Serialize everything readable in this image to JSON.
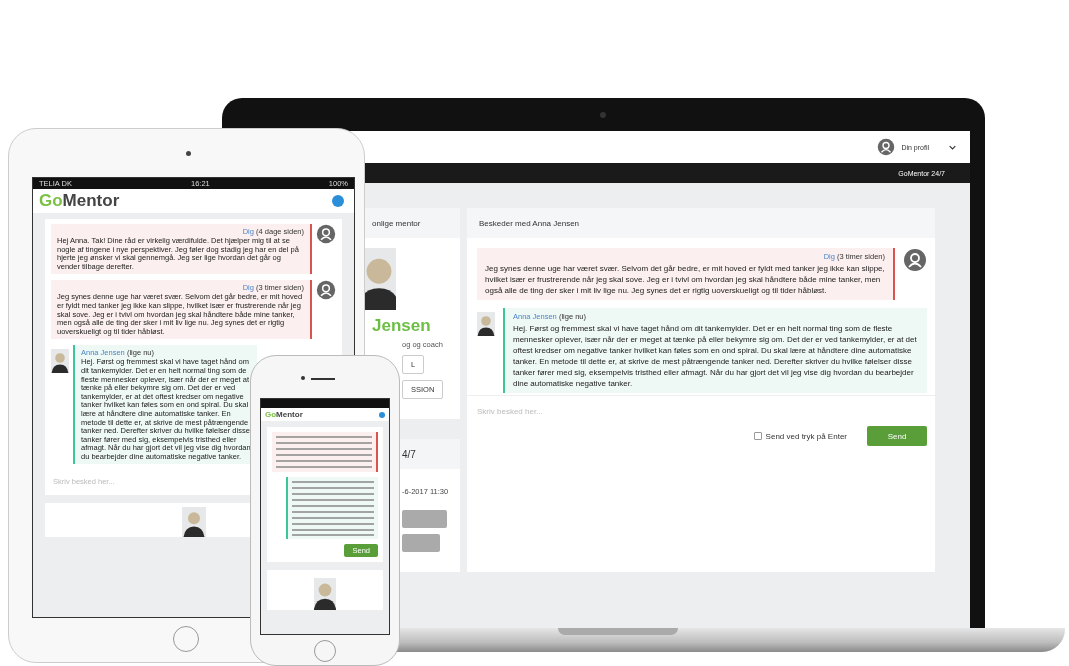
{
  "laptop": {
    "profile_label": "Din profil",
    "nav_item": "GoMentor 24/7",
    "mentor_panel": {
      "heading": "onlige mentor",
      "name": "Jensen",
      "role": "og og coach",
      "buttons": [
        "L",
        "SSION"
      ]
    },
    "schedule_panel": {
      "heading": "4/7",
      "datetime": "-6-2017 11:30"
    },
    "chat": {
      "title": "Beskeder med Anna Jensen",
      "messages": [
        {
          "kind": "sent",
          "author": "Dig",
          "time": "(3 timer siden)",
          "text": "Jeg synes denne uge har været svær. Selvom det går bedre, er mit hoved er fyldt med tanker jeg ikke kan slippe, hvilket især er frustrerende når jeg skal sove. Jeg er i tvivl om hvordan jeg skal håndtere både mine tanker, men også alle de ting der sker i mit liv lige nu. Jeg synes det er rigtig uoverskueligt og til tider håbløst."
        },
        {
          "kind": "received",
          "author": "Anna Jensen",
          "time": "(lige nu)",
          "text": "Hej. Først og fremmest skal vi have taget hånd om dit tankemylder. Det er en helt normal ting som de fleste mennesker oplever, især når der er meget at tænke på eller bekymre sig om. Det der er ved tankemylder, er at det oftest kredser om negative tanker hvilket kan føles som en ond spiral. Du skal lære at håndtere dine automatiske tanker. En metode til dette er, at skrive de mest påtrængende tanker ned. Derefter skriver du hvilke følelser disse tanker fører med sig, eksempelvis tristhed eller afmagt. Når du har gjort det vil jeg vise dig hvordan du bearbejder dine automatiske negative tanker."
        }
      ],
      "input": {
        "placeholder": "Skriv besked her..."
      },
      "enter_to_send": {
        "label": "Send ved tryk på Enter",
        "checked": false
      },
      "send_button": "Send"
    }
  },
  "tablet": {
    "status_bar": {
      "carrier": "TELIA DK",
      "time": "16:21",
      "battery": "100%"
    },
    "logo": {
      "prefix": "Go",
      "suffix": "Mentor"
    },
    "messages": [
      {
        "kind": "sent",
        "author": "Dig",
        "time": "(4 dage siden)",
        "text": "Hej Anna. Tak! Dine råd er virkelig værdifulde. Det hjælper mig til at se nogle af tingene i nye perspektiver. Jeg føler dog stadig jeg har en del på hjerte jeg ønsker vi skal gennemgå. Jeg ser lige hvordan det går og vender tilbage derefter."
      },
      {
        "kind": "sent",
        "author": "Dig",
        "time": "(3 timer siden)",
        "text": "Jeg synes denne uge har været svær. Selvom det går bedre, er mit hoved er fyldt med tanker jeg ikke kan slippe, hvilket især er frustrerende når jeg skal sove. Jeg er i tvivl om hvordan jeg skal håndtere både mine tanker, men også alle de ting der sker i mit liv lige nu. Jeg synes det er rigtig uoverskueligt og til tider håbløst."
      },
      {
        "kind": "received",
        "author": "Anna Jensen",
        "time": "(lige nu)",
        "text": "Hej. Først og fremmest skal vi have taget hånd om dit tankemylder. Det er en helt normal ting som de fleste mennesker oplever, især når der er meget at tænke på eller bekymre sig om. Det der er ved tankemylder, er at det oftest kredser om negative tanker hvilket kan føles som en ond spiral. Du skal lære at håndtere dine automatiske tanker. En metode til dette er, at skrive de mest påtrængende tanker ned. Derefter skriver du hvilke følelser disse tanker fører med sig, eksempelvis tristhed eller afmagt. Når du har gjort det vil jeg vise dig hvordan du bearbejder dine automatiske negative tanker."
      }
    ],
    "input": {
      "placeholder": "Skriv besked her..."
    }
  },
  "phone": {
    "logo": {
      "prefix": "Go",
      "suffix": "Mentor"
    },
    "send_button": "Send"
  }
}
